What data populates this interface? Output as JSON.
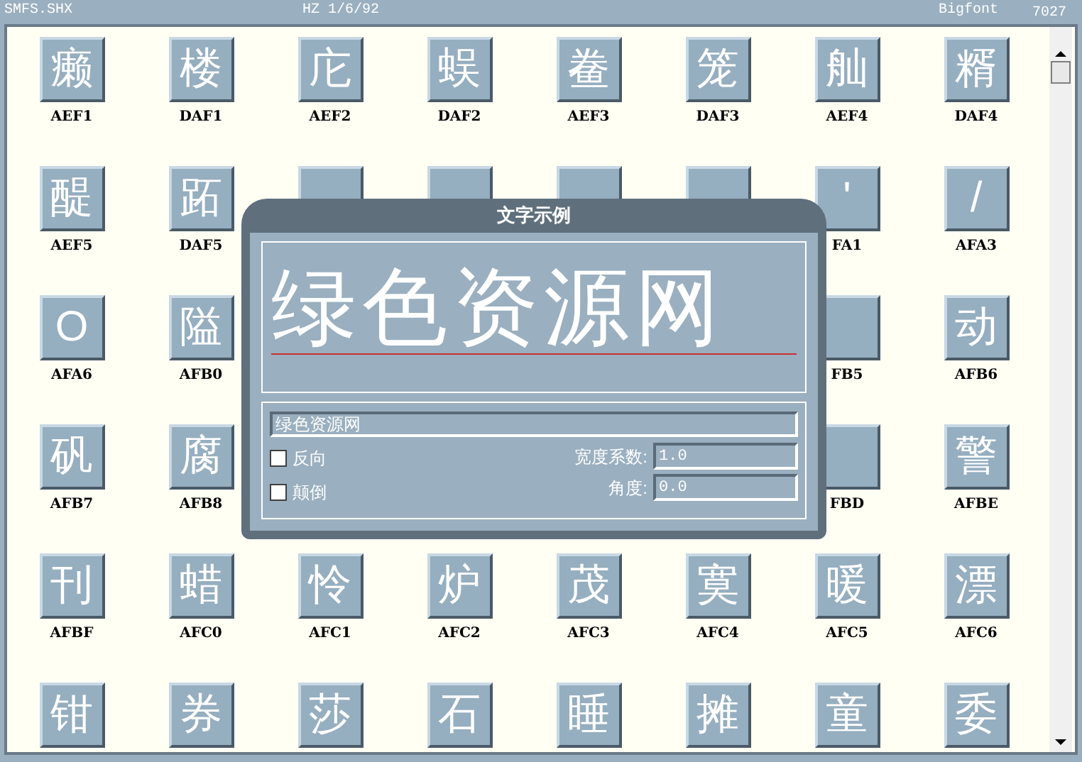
{
  "header": {
    "file": "SMFS.SHX",
    "version": "HZ 1/6/92",
    "type": "Bigfont",
    "count": "7027"
  },
  "grid": [
    [
      {
        "glyph": "癞",
        "code": "AEF1"
      },
      {
        "glyph": "楼",
        "code": "DAF1"
      },
      {
        "glyph": "庀",
        "code": "AEF2"
      },
      {
        "glyph": "蜈",
        "code": "DAF2"
      },
      {
        "glyph": "鲞",
        "code": "AEF3"
      },
      {
        "glyph": "笼",
        "code": "DAF3"
      },
      {
        "glyph": "舢",
        "code": "AEF4"
      },
      {
        "glyph": "糈",
        "code": "DAF4"
      }
    ],
    {
      "kind": "partial",
      "left": [
        {
          "glyph": "醍",
          "code": "AEF5"
        },
        {
          "glyph": "跖",
          "code": "DAF5"
        }
      ],
      "right": [
        {
          "glyph": "'",
          "code": "FA1"
        },
        {
          "glyph": "/",
          "code": "AFA3"
        }
      ]
    },
    {
      "kind": "hidden",
      "left": [
        {
          "glyph": "O",
          "code": "AFA6"
        },
        {
          "glyph": "隘",
          "code": "AFB0"
        }
      ],
      "right": [
        {
          "code": "FB5"
        },
        {
          "glyph": "动",
          "code": "AFB6"
        }
      ]
    },
    {
      "kind": "hidden",
      "left": [
        {
          "glyph": "矾",
          "code": "AFB7"
        },
        {
          "glyph": "腐",
          "code": "AFB8"
        }
      ],
      "right": [
        {
          "code": "FBD"
        },
        {
          "glyph": "警",
          "code": "AFBE"
        }
      ]
    },
    [
      {
        "glyph": "刊",
        "code": "AFBF"
      },
      {
        "glyph": "蜡",
        "code": "AFC0"
      },
      {
        "glyph": "怜",
        "code": "AFC1"
      },
      {
        "glyph": "炉",
        "code": "AFC2"
      },
      {
        "glyph": "茂",
        "code": "AFC3"
      },
      {
        "glyph": "寞",
        "code": "AFC4"
      },
      {
        "glyph": "暖",
        "code": "AFC5"
      },
      {
        "glyph": "漂",
        "code": "AFC6"
      }
    ],
    [
      {
        "glyph": "钳"
      },
      {
        "glyph": "券"
      },
      {
        "glyph": "莎"
      },
      {
        "glyph": "石"
      },
      {
        "glyph": "睡"
      },
      {
        "glyph": "摊"
      },
      {
        "glyph": "童"
      },
      {
        "glyph": "委"
      }
    ]
  ],
  "dialog": {
    "title": "文字示例",
    "preview": "绿色资源网",
    "text": "绿色资源网",
    "options": [
      {
        "label": "反向",
        "checked": false
      },
      {
        "label": "颠倒",
        "checked": false
      }
    ],
    "fields": [
      {
        "label": "宽度系数:",
        "value": "1.0"
      },
      {
        "label": "角度:",
        "value": "0.0"
      }
    ]
  }
}
